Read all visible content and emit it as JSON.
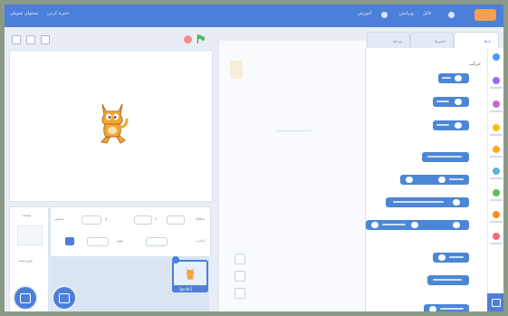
{
  "menubar": {
    "items": [
      "آموزش",
      "ویرایش",
      "فایل"
    ],
    "left_items": [
      "ذخیره کردن",
      "محتوای تحویلی"
    ],
    "logo": "scratch-logo"
  },
  "tabs": [
    "کدها",
    "لباس‌ها",
    "صداها"
  ],
  "palette": {
    "title": "حرکت"
  },
  "categories": [
    {
      "name": "motion",
      "color": "#4c97ff"
    },
    {
      "name": "looks",
      "color": "#9966ff"
    },
    {
      "name": "sound",
      "color": "#cf63cf"
    },
    {
      "name": "events",
      "color": "#ffbf00"
    },
    {
      "name": "control",
      "color": "#ffab19"
    },
    {
      "name": "sensing",
      "color": "#5cb1d6"
    },
    {
      "name": "operators",
      "color": "#59c059"
    },
    {
      "name": "variables",
      "color": "#ff8c1a"
    },
    {
      "name": "my-blocks",
      "color": "#ff6680"
    }
  ],
  "sprite_info": {
    "sprite_label": "شکلک",
    "x_label": "x",
    "y_label": "y",
    "show_label": "نمایش",
    "size_label": "اندازه",
    "direction_label": "جهت",
    "name_value": "Sprite1"
  },
  "stage_pane": {
    "label": "صحنه",
    "backdrops_label": "پس‌زمینه"
  },
  "sprite_thumb": {
    "name": "Sprite1"
  },
  "icons": {
    "green_flag": "green-flag-icon",
    "stop": "stop-icon",
    "cat": "cat-sprite-icon"
  }
}
